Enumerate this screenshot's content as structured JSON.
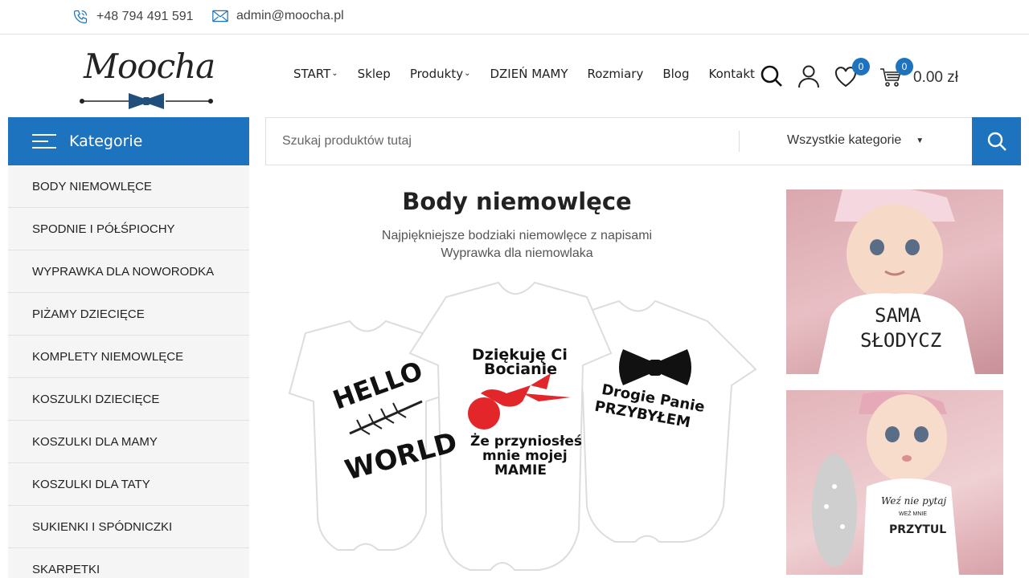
{
  "topbar": {
    "phone": "+48 794 491 591",
    "email": "admin@moocha.pl"
  },
  "logo": {
    "text": "Moocha"
  },
  "nav": {
    "items": [
      {
        "label": "START",
        "has_dropdown": true
      },
      {
        "label": "Sklep",
        "has_dropdown": false
      },
      {
        "label": "Produkty",
        "has_dropdown": true
      },
      {
        "label": "DZIEŃ MAMY",
        "has_dropdown": false
      },
      {
        "label": "Rozmiary",
        "has_dropdown": false
      },
      {
        "label": "Blog",
        "has_dropdown": false
      },
      {
        "label": "Kontakt",
        "has_dropdown": false
      }
    ]
  },
  "header_icons": {
    "wishlist_count": "0",
    "cart_count": "0",
    "cart_total": "0.00 zł"
  },
  "sidebar": {
    "header": "Kategorie",
    "items": [
      "BODY NIEMOWLĘCE",
      "SPODNIE I PÓŁŚPIOCHY",
      "WYPRAWKA DLA NOWORODKA",
      "PIŻAMY DZIECIĘCE",
      "KOMPLETY NIEMOWLĘCE",
      "KOSZULKI DZIECIĘCE",
      "KOSZULKI DLA MAMY",
      "KOSZULKI DLA TATY",
      "SUKIENKI I SPÓDNICZKI",
      "SKARPETKI"
    ]
  },
  "search": {
    "placeholder": "Szukaj produktów tutaj",
    "category": "Wszystkie kategorie"
  },
  "hero": {
    "title": "Body niemowlęce",
    "subtitle_line1": "Najpiękniejsze bodziaki niemowlęce z napisami",
    "subtitle_line2": "Wyprawka dla niemowlaka",
    "bodysuit_texts": [
      "HELLO",
      "WORLD",
      "Dziękuję Ci",
      "Bocianie",
      "Że przyniosłeś",
      "mnie mojej",
      "MAMIE",
      "Drogie Panie",
      "PRZYBYŁEM"
    ]
  },
  "side_photos": {
    "photo1_text": [
      "SAMA",
      "SŁODYCZ"
    ],
    "photo2_text": [
      "Weź nie pytaj",
      "WEŹ MNIE",
      "PRZYTUL"
    ]
  },
  "colors": {
    "accent": "#1e73be",
    "sidebar_bg": "#f5f5f5"
  }
}
